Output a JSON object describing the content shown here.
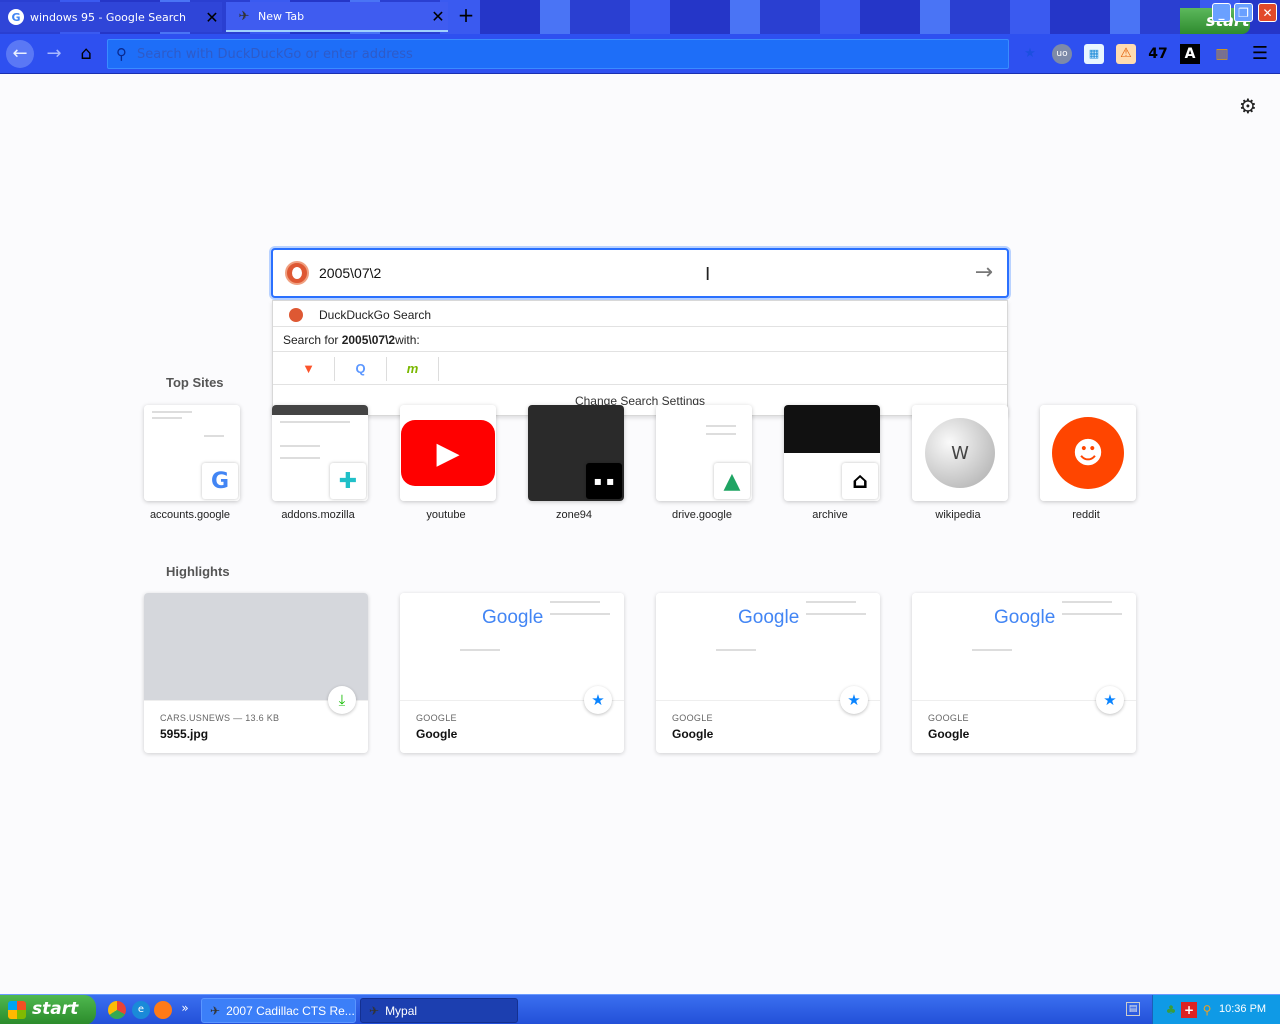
{
  "tabs": [
    {
      "title": "windows 95 - Google Search",
      "favicon": "google-g-icon"
    },
    {
      "title": "New Tab",
      "favicon": "mypal-icon"
    }
  ],
  "tab_strip": {
    "new_tab_symbol": "+",
    "close_symbol": "✕"
  },
  "window_controls": {
    "min": "_",
    "max": "❐",
    "close": "✕"
  },
  "corner_start_label": "start",
  "navbar": {
    "url_placeholder": "Search with DuckDuckGo or enter address",
    "extension_badge_count": "47",
    "font_ext_label": "A",
    "ublock_label": "uo"
  },
  "search": {
    "query": "2005\\07\\2",
    "suggestion_engine": "DuckDuckGo Search",
    "search_for_prefix": "Search for ",
    "search_for_query": "2005\\07\\2",
    "search_for_suffix": " with:",
    "change_settings": "Change Search Settings",
    "one_off_engines": [
      "brave-icon",
      "qwant-icon",
      "mojeek-icon"
    ]
  },
  "top_sites_heading": "Top Sites",
  "top_sites": [
    {
      "label": "accounts.google",
      "icon": "google-g-icon",
      "color": "#4285f4"
    },
    {
      "label": "addons.mozilla",
      "icon": "puzzle-piece-icon",
      "color": "#20c0c8"
    },
    {
      "label": "youtube",
      "icon": "youtube-play-icon",
      "color": "#ff0000"
    },
    {
      "label": "zone94",
      "icon": "zone94-icon",
      "color": "#111111"
    },
    {
      "label": "drive.google",
      "icon": "google-drive-icon",
      "color": "#1fa463"
    },
    {
      "label": "archive",
      "icon": "archive-building-icon",
      "color": "#000000"
    },
    {
      "label": "wikipedia",
      "icon": "wikipedia-globe-icon",
      "color": "#888888"
    },
    {
      "label": "reddit",
      "icon": "reddit-alien-icon",
      "color": "#ff4500"
    }
  ],
  "highlights_heading": "Highlights",
  "highlights": [
    {
      "meta": "CARS.USNEWS — 13.6 KB",
      "title": "5955.jpg",
      "badge": "download-icon"
    },
    {
      "meta": "GOOGLE",
      "title": "Google",
      "badge": "bookmark-star-icon",
      "logo": "Google"
    },
    {
      "meta": "GOOGLE",
      "title": "Google",
      "badge": "bookmark-star-icon",
      "logo": "Google"
    },
    {
      "meta": "GOOGLE",
      "title": "Google",
      "badge": "bookmark-star-icon",
      "logo": "Google"
    }
  ],
  "taskbar": {
    "start_label": "start",
    "tasks": [
      {
        "label": "2007 Cadillac CTS Re...",
        "icon": "mypal-icon"
      },
      {
        "label": "Mypal",
        "icon": "mypal-icon"
      }
    ],
    "clock": "10:36 PM"
  },
  "colors": {
    "accent": "#2a70ff",
    "tabstrip": "#2a3fd1",
    "navbar": "#2e50f0",
    "taskbar": "#2350d8",
    "start_green": "#2a8a2a"
  }
}
